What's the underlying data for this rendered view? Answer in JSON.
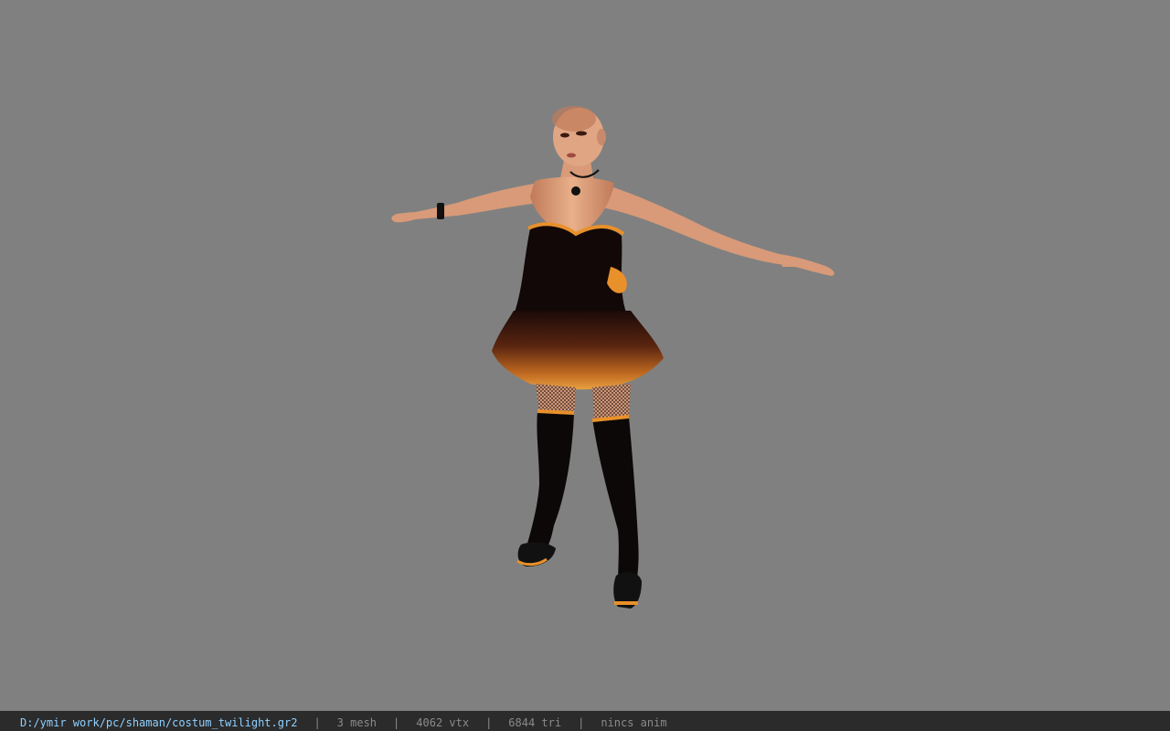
{
  "app": {
    "background_color": "#808080",
    "statusbar_color": "#2b2b2b"
  },
  "statusbar": {
    "file_path": "D:/ymir work/pc/shaman/costum_twilight.gr2",
    "mesh_count": "3 mesh",
    "vertex_count": "4062 vtx",
    "triangle_count": "6844 tri",
    "anim_status": "nincs anim",
    "separator": "|",
    "path_color": "#8fd0ff",
    "info_color": "#8a8a8a"
  },
  "viewport": {
    "model_icon": "character-model-t-pose"
  }
}
